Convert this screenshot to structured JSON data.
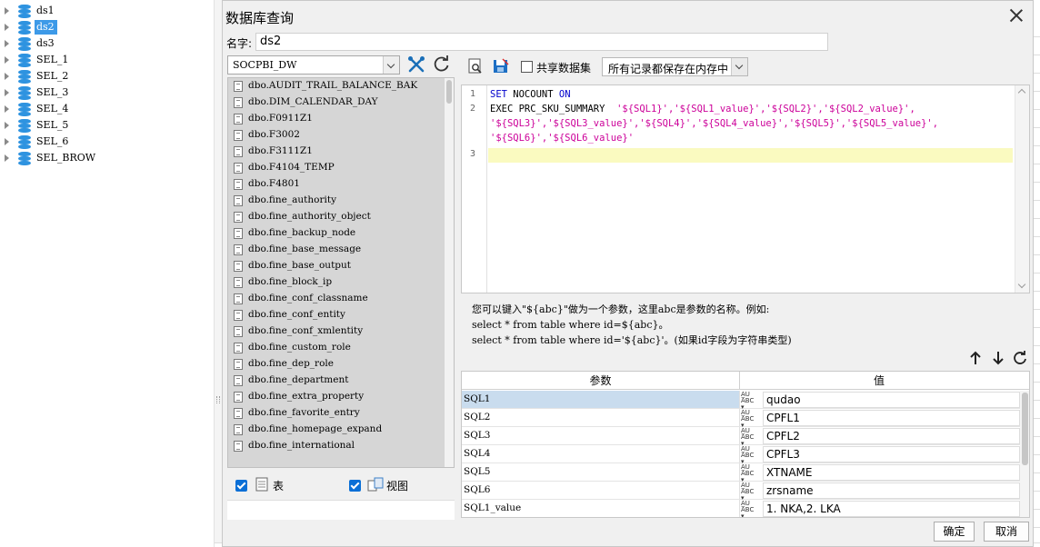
{
  "datasets": [
    {
      "label": "ds1"
    },
    {
      "label": "ds2",
      "selected": true
    },
    {
      "label": "ds3"
    },
    {
      "label": "SEL_1"
    },
    {
      "label": "SEL_2"
    },
    {
      "label": "SEL_3"
    },
    {
      "label": "SEL_4"
    },
    {
      "label": "SEL_5"
    },
    {
      "label": "SEL_6"
    },
    {
      "label": "SEL_BROW"
    }
  ],
  "dialog": {
    "title": "数据库查询",
    "name_label": "名字:",
    "name_value": "ds2"
  },
  "left_panel": {
    "database": "SOCPBI_DW",
    "tables": [
      "dbo.AUDIT_TRAIL_BALANCE_BAK",
      "dbo.DIM_CALENDAR_DAY",
      "dbo.F0911Z1",
      "dbo.F3002",
      "dbo.F3111Z1",
      "dbo.F4104_TEMP",
      "dbo.F4801",
      "dbo.fine_authority",
      "dbo.fine_authority_object",
      "dbo.fine_backup_node",
      "dbo.fine_base_message",
      "dbo.fine_base_output",
      "dbo.fine_block_ip",
      "dbo.fine_conf_classname",
      "dbo.fine_conf_entity",
      "dbo.fine_conf_xmlentity",
      "dbo.fine_custom_role",
      "dbo.fine_dep_role",
      "dbo.fine_department",
      "dbo.fine_extra_property",
      "dbo.fine_favorite_entry",
      "dbo.fine_homepage_expand",
      "dbo.fine_international"
    ],
    "show_tables_label": "表",
    "show_views_label": "视图"
  },
  "toolbar": {
    "share_label": "共享数据集",
    "memory_mode": "所有记录都保存在内存中"
  },
  "editor": {
    "line_numbers": [
      "1",
      "2",
      "3"
    ],
    "line1_kw1": "SET",
    "line1_mid": " NOCOUNT ",
    "line1_kw2": "ON",
    "line2_prefix": "EXEC PRC_SKU_SUMMARY  ",
    "line2_args": "'${SQL1}','${SQL1_value}','${SQL2}','${SQL2_value}',",
    "line2b_args": "'${SQL3}','${SQL3_value}','${SQL4}','${SQL4_value}','${SQL5}','${SQL5_value}',",
    "line2c_args": "'${SQL6}','${SQL6_value}'"
  },
  "hint": {
    "line1": "您可以键入\"${abc}\"做为一个参数，这里abc是参数的名称。例如:",
    "line2": "select * from table where id=${abc}。",
    "line3": "select * from table where id='${abc}'。(如果id字段为字符串类型)"
  },
  "params": {
    "col_param": "参数",
    "col_value": "值",
    "rows": [
      {
        "name": "SQL1",
        "value": "qudao",
        "selected": true
      },
      {
        "name": "SQL2",
        "value": "CPFL1"
      },
      {
        "name": "SQL4",
        "value": "CPFL3"
      },
      {
        "name": "SQL3",
        "value": "CPFL2"
      },
      {
        "name": "SQL5",
        "value": "XTNAME"
      },
      {
        "name": "SQL6",
        "value": "zrsname"
      },
      {
        "name": "SQL1_value",
        "value": "1. NKA,2. LKA"
      }
    ],
    "type_icon": "abc-type-icon"
  },
  "buttons": {
    "ok": "确定",
    "cancel": "取消"
  },
  "colors": {
    "selection": "#3d9ae8",
    "db_icon": "#2e93e0",
    "keyword": "#0000cc",
    "string": "#cc0099",
    "current_line": "#fafac0"
  }
}
